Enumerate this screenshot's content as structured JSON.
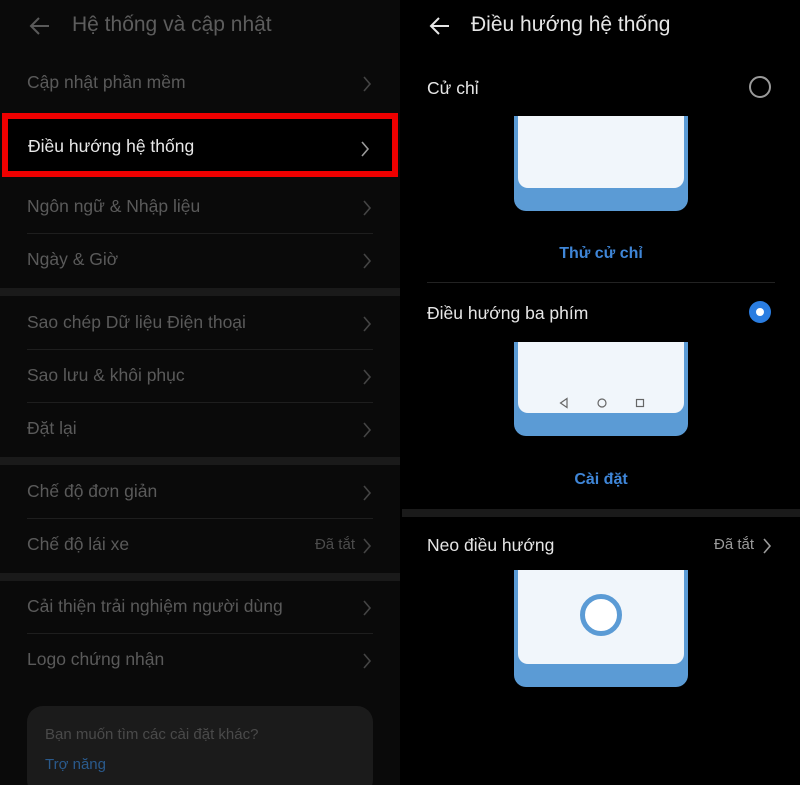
{
  "left": {
    "title": "Hệ thống và cập nhật",
    "items": [
      {
        "label": "Cập nhật phần mềm",
        "value": ""
      },
      {
        "label": "Điều hướng hệ thống",
        "value": ""
      },
      {
        "label": "Ngôn ngữ & Nhập liệu",
        "value": ""
      },
      {
        "label": "Ngày & Giờ",
        "value": ""
      },
      {
        "label": "Sao chép Dữ liệu Điện thoại",
        "value": ""
      },
      {
        "label": "Sao lưu & khôi phục",
        "value": ""
      },
      {
        "label": "Đặt lại",
        "value": ""
      },
      {
        "label": "Chế độ đơn giản",
        "value": ""
      },
      {
        "label": "Chế độ lái xe",
        "value": "Đã tắt"
      },
      {
        "label": "Cải thiện trải nghiệm người dùng",
        "value": ""
      },
      {
        "label": "Logo chứng nhận",
        "value": ""
      }
    ],
    "card": {
      "question": "Bạn muốn tìm các cài đặt khác?",
      "link": "Trợ năng"
    }
  },
  "right": {
    "title": "Điều hướng hệ thống",
    "gesture": {
      "label": "Cử chỉ",
      "selected": false,
      "action": "Thử cử chỉ"
    },
    "three_key": {
      "label": "Điều hướng ba phím",
      "selected": true,
      "action": "Cài đặt"
    },
    "dock": {
      "label": "Neo điều hướng",
      "value": "Đã tắt"
    }
  },
  "colors": {
    "highlight_border": "#ee0000",
    "accent": "#2a7de1",
    "link": "#3f86d8",
    "phone_frame": "#5b9bd5"
  },
  "icons": [
    "back-arrow-icon",
    "chevron-right-icon",
    "radio-icon",
    "nav-back-icon",
    "nav-home-icon",
    "nav-recents-icon"
  ]
}
